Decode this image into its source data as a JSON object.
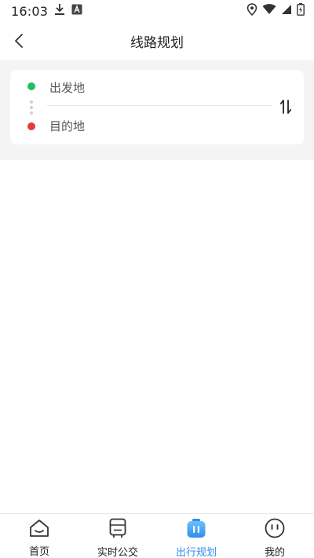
{
  "status_bar": {
    "time": "16:03"
  },
  "header": {
    "title": "线路规划"
  },
  "route": {
    "start_label": "出发地",
    "end_label": "目的地"
  },
  "tabbar": {
    "items": [
      {
        "label": "首页",
        "icon": "home-icon"
      },
      {
        "label": "实时公交",
        "icon": "bus-icon"
      },
      {
        "label": "出行规划",
        "icon": "trip-plan-icon",
        "active": true
      },
      {
        "label": "我的",
        "icon": "profile-face-icon"
      }
    ]
  },
  "colors": {
    "start_dot": "#1fbe63",
    "end_dot": "#e23b3b",
    "active_tab": "#2f8fe8",
    "band_background": "#f4f4f5"
  }
}
